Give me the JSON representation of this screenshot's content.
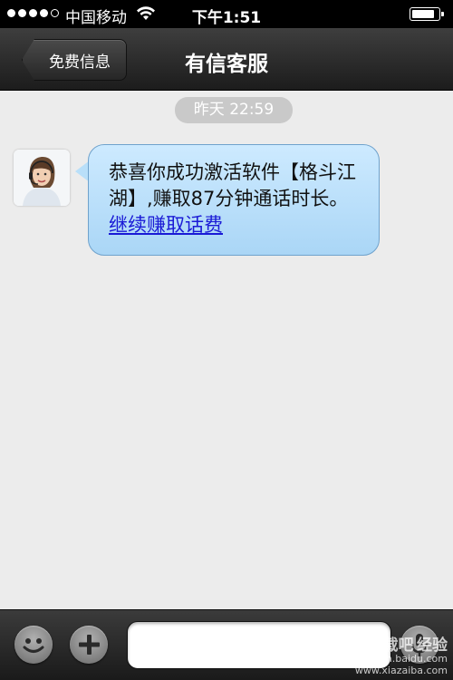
{
  "status_bar": {
    "carrier": "中国移动",
    "time": "下午1:51",
    "signal_bars": 4,
    "battery_level": 0.85
  },
  "nav": {
    "back_label": "免费信息",
    "title": "有信客服"
  },
  "chat": {
    "timestamp": "昨天 22:59",
    "messages": [
      {
        "sender": "agent",
        "text": "恭喜你成功激活软件【格斗江湖】,赚取87分钟通话时长。",
        "link_text": "继续赚取话费"
      }
    ]
  },
  "input_bar": {
    "placeholder": "",
    "emoji_icon": "smiley-icon",
    "add_icon": "plus-icon",
    "voice_icon": "microphone-icon"
  },
  "watermark": {
    "line1": "下载吧",
    "line2": "经验",
    "line3": "jingyan.baidu.com",
    "line4": "www.xiazaiba.com"
  },
  "colors": {
    "bubble": "#b9dff9",
    "link": "#1a1ad6",
    "nav_bg": "#2a2a2a",
    "chat_bg": "#ececec"
  }
}
